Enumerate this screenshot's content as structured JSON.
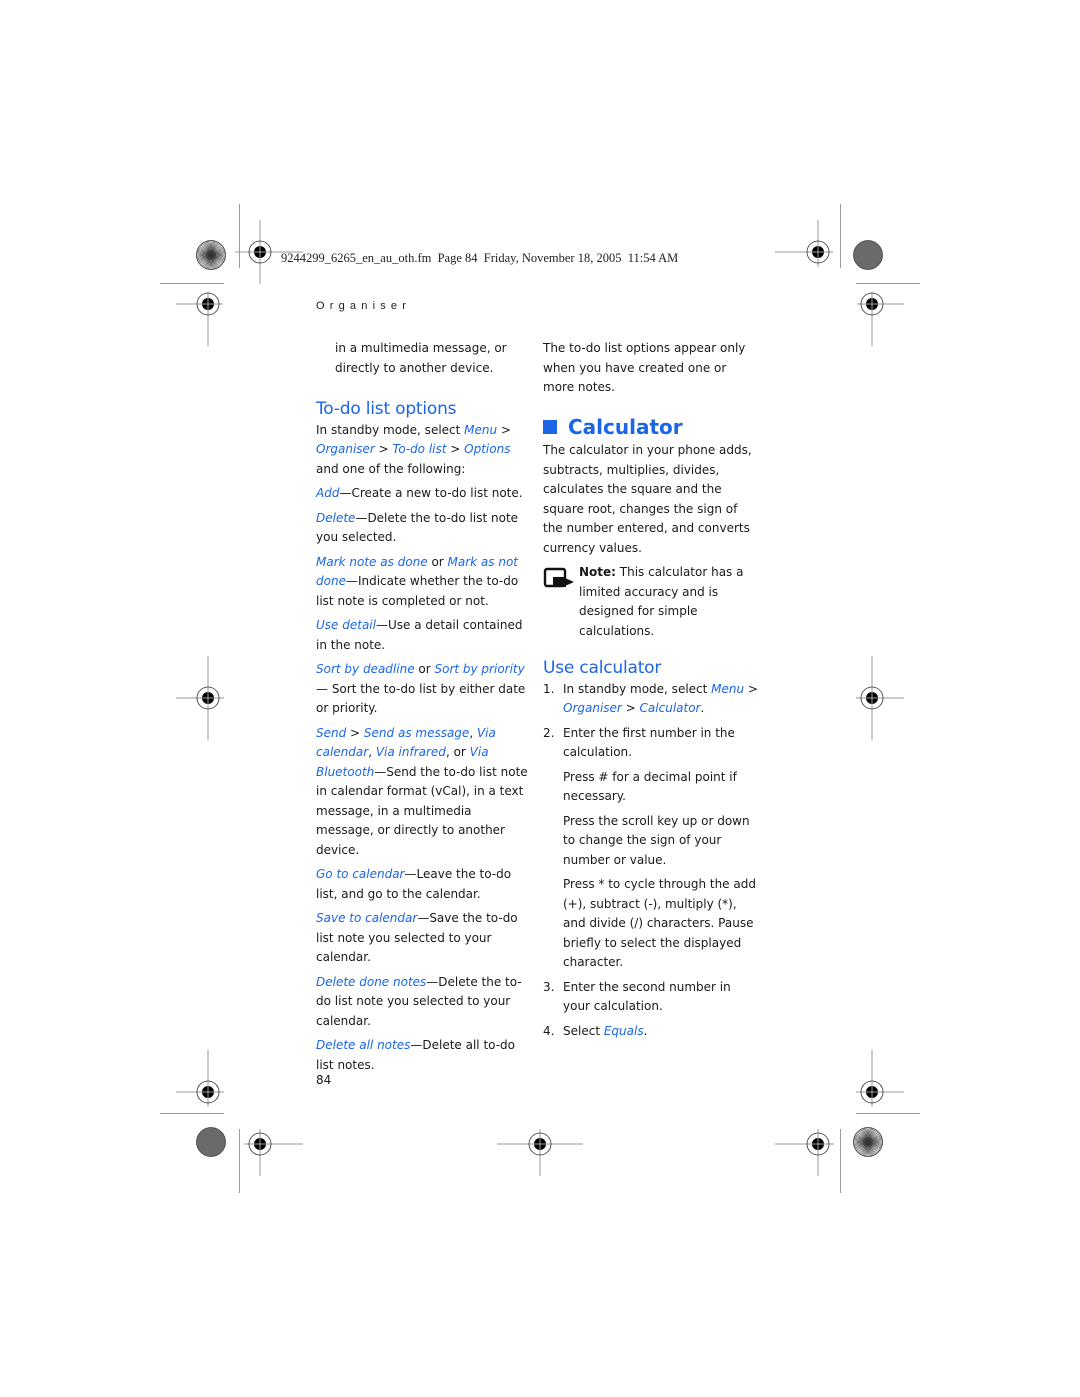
{
  "slug": "9244299_6265_en_au_oth.fm  Page 84  Friday, November 18, 2005  11:54 AM",
  "running_head": "Organiser",
  "page_number": "84",
  "colors": {
    "accent": "#1a66e6",
    "text": "#1a1a1a",
    "crop_marks": "#9a9a9a"
  },
  "left_column": {
    "continuation": "in a multimedia message, or directly to another device.",
    "todo_heading": "To-do list options",
    "intro": {
      "t1": "In standby mode, select ",
      "l1": "Menu",
      "t2": " > ",
      "l2": "Organiser",
      "t3": " > ",
      "l3": "To-do list",
      "t4": " > ",
      "l4": "Options",
      "t5": " and one of the following:"
    },
    "options": [
      {
        "link": "Add",
        "text": "—Create a new to-do list note."
      },
      {
        "link": "Delete",
        "text": "—Delete the to-do list note you selected."
      },
      {
        "link": "Mark note as done",
        "mid": " or ",
        "link2": "Mark as not done",
        "text": "—Indicate whether the to-do list note is completed or not."
      },
      {
        "link": "Use detail",
        "text": "—Use a detail contained in the note."
      },
      {
        "link": "Sort by deadline",
        "mid": " or ",
        "link2": "Sort by priority",
        "text": "— Sort the to-do list by either date or priority."
      },
      {
        "link": "Send",
        "mid": " > ",
        "link2": "Send as message",
        "sep2": ", ",
        "link3": "Via calendar",
        "sep3": ", ",
        "link4": "Via infrared",
        "sep4": ", or ",
        "link5": "Via Bluetooth",
        "text": "—Send the to-do list note in calendar format (vCal), in a text message, in a multimedia message, or directly to another device."
      },
      {
        "link": "Go to calendar",
        "text": "—Leave the to-do list, and go to the calendar."
      },
      {
        "link": "Save to calendar",
        "text": "—Save the to-do list note you selected to your calendar."
      },
      {
        "link": "Delete done notes",
        "text": "—Delete the to-do list note you selected to your calendar."
      },
      {
        "link": "Delete all notes",
        "text": "—Delete all to-do list notes."
      }
    ]
  },
  "right_column": {
    "todo_note": "The to-do list options appear only when you have created one or more notes.",
    "calc_heading": "Calculator",
    "calc_intro": "The calculator in your phone adds, subtracts, multiplies, divides, calculates the square and the square root, changes the sign of the number entered, and converts currency values.",
    "note": {
      "icon": "note-icon",
      "label": "Note:",
      "text": " This calculator has a limited accuracy and is designed for simple calculations."
    },
    "use_heading": "Use calculator",
    "steps": [
      {
        "num": "1.",
        "t1": "In standby mode, select ",
        "l1": "Menu",
        "t2": " > ",
        "l2": "Organiser",
        "t3": " > ",
        "l3": "Calculator",
        "t4": "."
      },
      {
        "num": "2.",
        "text": "Enter the first number in the calculation.",
        "sub": [
          "Press # for a decimal point if necessary.",
          "Press the scroll key up or down to change the sign of your number or value.",
          "Press * to cycle through the add (+), subtract (-), multiply (*), and divide (/) characters. Pause briefly to select the displayed character."
        ]
      },
      {
        "num": "3.",
        "text": "Enter the second number in your calculation."
      },
      {
        "num": "4.",
        "t1": "Select ",
        "l1": "Equals",
        "t2": "."
      }
    ]
  }
}
